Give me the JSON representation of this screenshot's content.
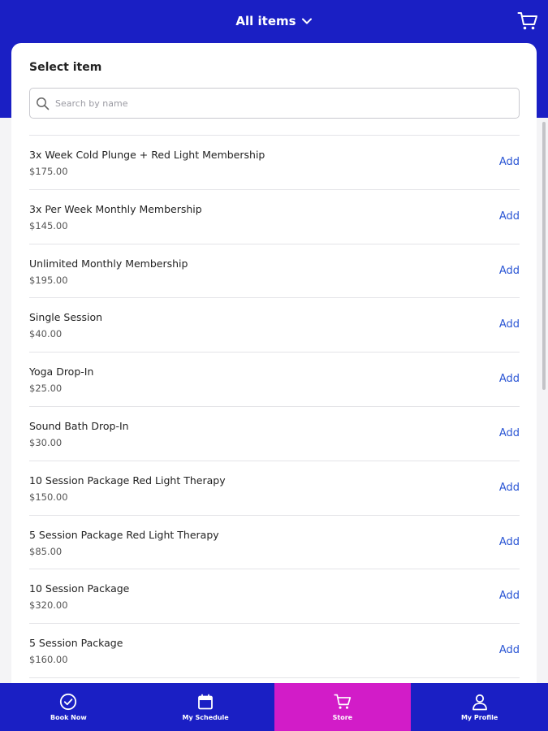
{
  "header": {
    "title": "All items",
    "dropdown_icon": "chevron-down-icon",
    "cart_icon": "cart-icon"
  },
  "panel": {
    "heading": "Select item",
    "search": {
      "placeholder": "Search by name",
      "value": "",
      "icon": "search-icon"
    }
  },
  "items": [
    {
      "name": "3x Week Cold Plunge + Red Light Membership",
      "price": "$175.00",
      "action": "Add"
    },
    {
      "name": "3x Per Week Monthly Membership",
      "price": "$145.00",
      "action": "Add"
    },
    {
      "name": "Unlimited Monthly Membership",
      "price": "$195.00",
      "action": "Add"
    },
    {
      "name": "Single Session",
      "price": "$40.00",
      "action": "Add"
    },
    {
      "name": "Yoga Drop-In",
      "price": "$25.00",
      "action": "Add"
    },
    {
      "name": "Sound Bath Drop-In",
      "price": "$30.00",
      "action": "Add"
    },
    {
      "name": "10 Session Package Red Light Therapy",
      "price": "$150.00",
      "action": "Add"
    },
    {
      "name": "5 Session Package Red Light Therapy",
      "price": "$85.00",
      "action": "Add"
    },
    {
      "name": "10 Session Package",
      "price": "$320.00",
      "action": "Add"
    },
    {
      "name": "5 Session Package",
      "price": "$160.00",
      "action": "Add"
    }
  ],
  "bottom_nav": [
    {
      "label": "Book Now",
      "icon": "check-circle-icon",
      "active": false
    },
    {
      "label": "My Schedule",
      "icon": "calendar-icon",
      "active": false
    },
    {
      "label": "Store",
      "icon": "cart-icon",
      "active": true
    },
    {
      "label": "My Profile",
      "icon": "user-icon",
      "active": false
    }
  ],
  "colors": {
    "brand": "#1a1fc4",
    "active_tab": "#d21cc8",
    "link": "#2a55d4"
  }
}
